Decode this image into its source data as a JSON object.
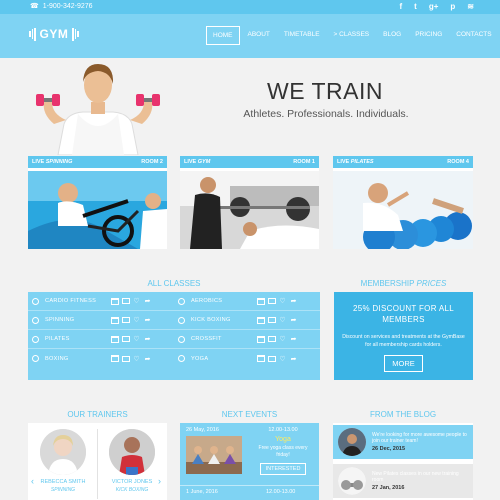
{
  "topbar": {
    "phone": "1-900-342-9276",
    "socials": [
      {
        "icon": "facebook-icon",
        "glyph": "f"
      },
      {
        "icon": "twitter-icon",
        "glyph": "t"
      },
      {
        "icon": "googleplus-icon",
        "glyph": "g+"
      },
      {
        "icon": "pinterest-icon",
        "glyph": "p"
      },
      {
        "icon": "rss-icon",
        "glyph": "≋"
      }
    ]
  },
  "brand": {
    "name": "GYM"
  },
  "nav": {
    "items": [
      "HOME",
      "ABOUT",
      "TIMETABLE",
      "> CLASSES",
      "BLOG",
      "PRICING",
      "CONTACTS"
    ],
    "active": "HOME"
  },
  "hero": {
    "headline": "WE TRAIN",
    "subline": "Athletes. Professionals. Individuals."
  },
  "live": [
    {
      "prefix": "LIVE",
      "name": "SPINNING",
      "room": "ROOM 2"
    },
    {
      "prefix": "LIVE",
      "name": "GYM",
      "room": "ROOM 1"
    },
    {
      "prefix": "LIVE",
      "name": "PILATES",
      "room": "ROOM 4"
    }
  ],
  "classes": {
    "title": "ALL CLASSES",
    "rows": [
      [
        "CARDIO FITNESS",
        "AEROBICS"
      ],
      [
        "SPINNING",
        "KICK BOXING"
      ],
      [
        "PILATES",
        "CROSSFIT"
      ],
      [
        "BOXING",
        "YOGA"
      ]
    ]
  },
  "membership": {
    "title_plain": "MEMBERSHIP",
    "title_italic": "PRICES",
    "headline": "25% DISCOUNT FOR ALL MEMBERS",
    "text": "Discount on services and treatments at the GymBase for all membership cards holders.",
    "button": "MORE"
  },
  "trainers": {
    "title": "OUR TRAINERS",
    "items": [
      {
        "name": "REBECCA SMITH",
        "role": "SPINNING"
      },
      {
        "name": "VICTOR JONES",
        "role": "KICK BOXING"
      }
    ],
    "prev": "‹",
    "next": "›"
  },
  "events": {
    "title": "NEXT EVENTS",
    "items": [
      {
        "date": "26 May, 2016",
        "time": "12.00-13.00",
        "name": "Yoga",
        "desc": "Free yoga class every friday!",
        "button": "INTERESTED"
      },
      {
        "date": "1 June, 2016",
        "time": "12.00-13.00"
      }
    ]
  },
  "blog": {
    "title": "FROM THE BLOG",
    "posts": [
      {
        "title": "We're looking for more awesome people to join our trainer team!",
        "date": "26 Dec, 2015"
      },
      {
        "title": "New Pilates classes in our new training room",
        "date": "27 Jan, 2016"
      }
    ]
  },
  "colors": {
    "accent": "#5fc7ee",
    "accent_light": "#7fd3f3",
    "accent_dark": "#3bb4e5",
    "event_highlight": "#ffec5f"
  }
}
